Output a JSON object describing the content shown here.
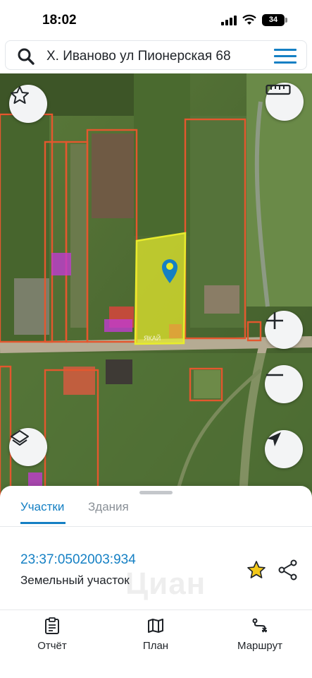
{
  "status_bar": {
    "time": "18:02",
    "battery": "34"
  },
  "search": {
    "query": "Х. Иваново ул Пионерская 68"
  },
  "map": {
    "parcel_label": "ЯКАЙ",
    "highlight_color": "#e8ec2c",
    "boundary_color": "#e4572e",
    "building_color": "#c03ccf"
  },
  "sheet": {
    "tabs": [
      {
        "label": "Участки",
        "active": true
      },
      {
        "label": "Здания",
        "active": false
      }
    ],
    "parcel": {
      "cadastral_number": "23:37:0502003:934",
      "type": "Земельный участок",
      "watermark": "Циан"
    }
  },
  "bottom_nav": [
    {
      "label": "Отчёт",
      "icon": "report-icon"
    },
    {
      "label": "План",
      "icon": "map-plan-icon"
    },
    {
      "label": "Маршрут",
      "icon": "route-icon"
    }
  ],
  "colors": {
    "accent": "#1580c4",
    "star": "#f2c81a"
  }
}
